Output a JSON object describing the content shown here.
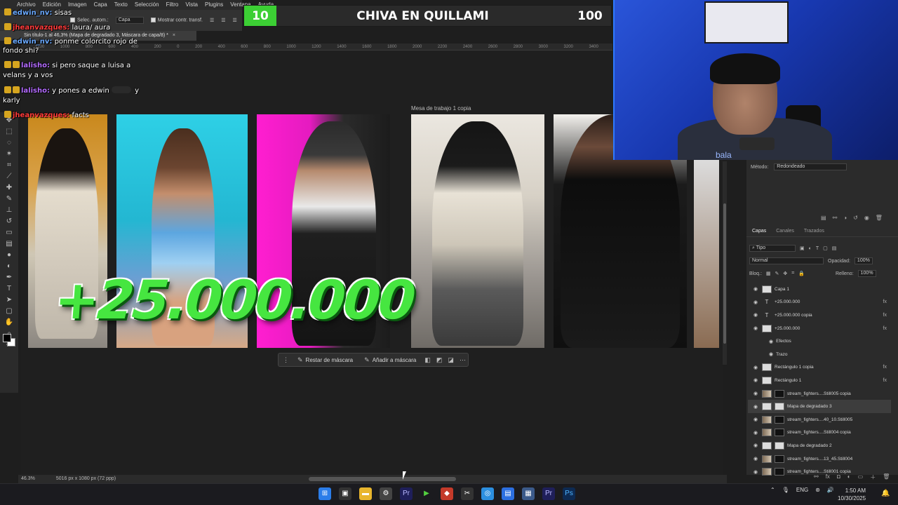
{
  "menubar": [
    "Archivo",
    "Edición",
    "Imagen",
    "Capa",
    "Texto",
    "Selección",
    "Filtro",
    "Vista",
    "Plugins",
    "Ventana",
    "Ayuda"
  ],
  "options": {
    "autoselect": "Selec. autom.:",
    "layer": "Capa",
    "show_transform": "Mostrar contr. transf."
  },
  "document_tab": {
    "title": "Sin título-1 al 46,3% (Mapa de degradado 3, Máscara de capa/8) *",
    "close": "×"
  },
  "ruler_ticks": [
    "1200",
    "1000",
    "800",
    "600",
    "400",
    "200",
    "0",
    "200",
    "400",
    "600",
    "800",
    "1000",
    "1200",
    "1400",
    "1600",
    "1800",
    "2000",
    "2200",
    "2400",
    "2600",
    "2800",
    "3000",
    "3200",
    "3400"
  ],
  "artboard_label": "Mesa de trabajo 1 copia",
  "canvas_text": {
    "big_number": "+25.000.000"
  },
  "mask_bar": {
    "subtract": "Restar de máscara",
    "add": "Añadir a máscara"
  },
  "status": {
    "zoom": "46.3%",
    "size": "5016 px x 1080 px (72 ppp)"
  },
  "score": {
    "left": "10",
    "title": "CHIVA EN QUILLAMI",
    "right": "100"
  },
  "chat": [
    {
      "user": "edwin_nv:",
      "text": "sisas",
      "color": "blue"
    },
    {
      "user": "jheanvazques:",
      "text": "laura/ aura",
      "color": "red"
    },
    {
      "user": "edwin_nv:",
      "text": "ponme colorcito rojo de",
      "color": "blue"
    },
    {
      "user": "",
      "text": "fondo shi?",
      "color": "white"
    },
    {
      "user": "lalisho:",
      "text": "si pero saque a luisa a",
      "color": "violet"
    },
    {
      "user": "",
      "text": "velans y a vos",
      "color": "white"
    },
    {
      "user": "lalisho:",
      "text": "y pones a edwin",
      "color": "violet"
    },
    {
      "user": "",
      "text": "y",
      "color": "white"
    },
    {
      "user": "",
      "text": "karly",
      "color": "white"
    },
    {
      "user": "jheanvazques:",
      "text": "facts",
      "color": "red"
    }
  ],
  "properties": {
    "method_label": "Método:",
    "method_value": "Redondeado"
  },
  "panel_tabs": [
    "Capas",
    "Canales",
    "Trazados"
  ],
  "layer_controls": {
    "filter": "Tipo",
    "blend": "Normal",
    "opacity_label": "Opacidad:",
    "opacity": "100%",
    "lock_label": "Bloq.:",
    "fill_label": "Relleno:",
    "fill": "100%"
  },
  "layers": [
    {
      "name": "Capa 1",
      "type": "group"
    },
    {
      "name": "+25.000.000",
      "type": "text",
      "fx": "fx"
    },
    {
      "name": "+25.000.000 copia",
      "type": "text",
      "fx": "fx"
    },
    {
      "name": "+25.000.000",
      "type": "smart",
      "fx": "fx"
    },
    {
      "name": "Efectos",
      "type": "sub"
    },
    {
      "name": "Trazo",
      "type": "sub"
    },
    {
      "name": "Rectángulo 1 copia",
      "type": "shape",
      "fx": "fx"
    },
    {
      "name": "Rectángulo 1",
      "type": "shape",
      "fx": "fx"
    },
    {
      "name": "stream_fighters....Still005 copia",
      "type": "photo"
    },
    {
      "name": "Mapa de degradado 3",
      "type": "adjust",
      "selected": true
    },
    {
      "name": "stream_fighters....40_10.Still005",
      "type": "photo"
    },
    {
      "name": "stream_fighters....Still004 copia",
      "type": "photo"
    },
    {
      "name": "Mapa de degradado 2",
      "type": "adjust"
    },
    {
      "name": "stream_fighters....13_45.Still004",
      "type": "photo"
    },
    {
      "name": "stream_fighters....Still001 copia",
      "type": "photo"
    }
  ],
  "webcam": {
    "overlay_text": "bala"
  },
  "taskbar": {
    "lang": "ENG",
    "time": "1:50 AM",
    "date": "10/30/2025"
  },
  "colors": {
    "accent_green": "#3ccf34",
    "number_green": "#46e640",
    "webcam_blue": "#2a55d9",
    "chat_blue": "#6aa9ff",
    "chat_violet": "#b36bff",
    "chat_red": "#ff3a3a"
  }
}
